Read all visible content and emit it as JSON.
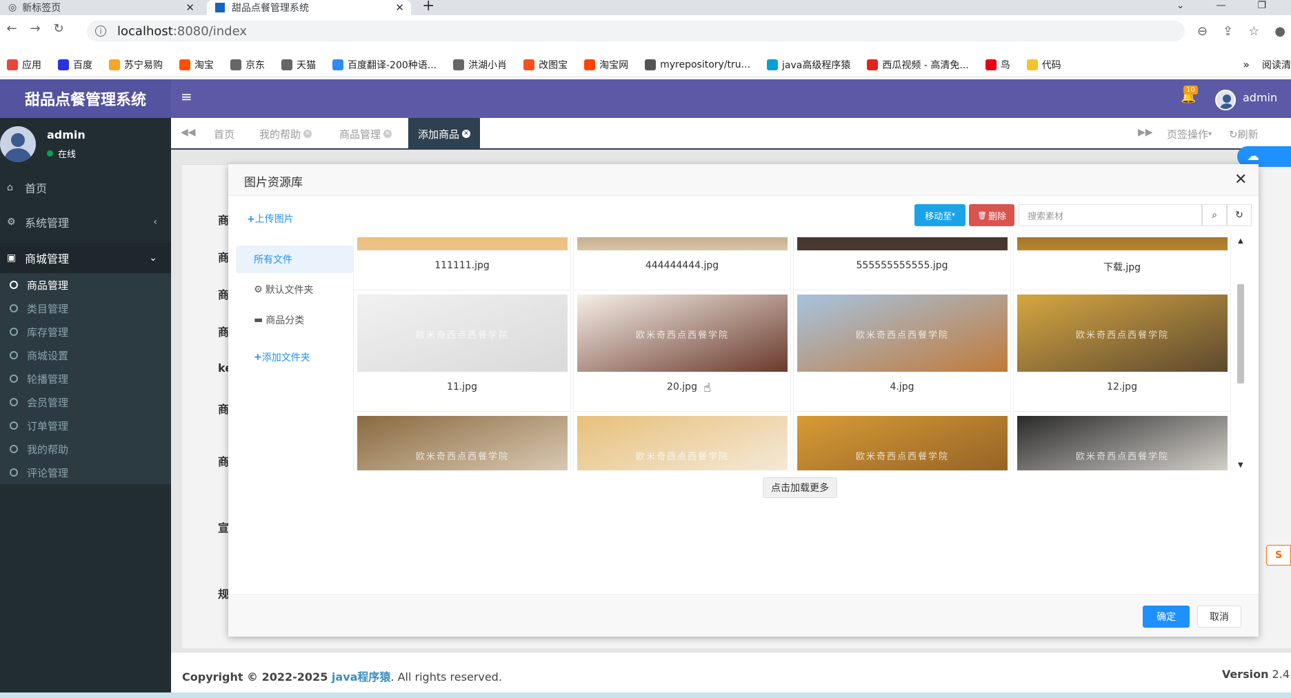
{
  "browser": {
    "tabs": [
      {
        "label": "新标签页"
      },
      {
        "label": "甜品点餐管理系统"
      }
    ],
    "url_host": "localhost",
    "url_path": ":8080/index",
    "bookmarks": [
      "应用",
      "百度",
      "苏宁易购",
      "淘宝",
      "京东",
      "天猫",
      "百度翻译-200种语...",
      "洪湖小肖",
      "改图宝",
      "淘宝网",
      "myrepository/tru...",
      "java高级程序猿",
      "西瓜视频 - 高清免...",
      "鸟",
      "代码"
    ],
    "reading_list": "阅读清",
    "bookmark_colors": [
      "#e8453c",
      "#2932e1",
      "#f5a623",
      "#ff5000",
      "#666666",
      "#666666",
      "#2d8cf0",
      "#666666",
      "#f4511e",
      "#ff4400",
      "#555555",
      "#00a1d6",
      "#e1251b",
      "#e60012",
      "#f4c430"
    ]
  },
  "app": {
    "brand": "甜品点餐管理系统",
    "notif_count": "10",
    "header_user": "admin",
    "accent": "#5c5aa6"
  },
  "sidebar": {
    "user": "admin",
    "status": "在线",
    "home": "首页",
    "system": "系统管理",
    "shop": "商城管理",
    "sub_items": [
      "商品管理",
      "类目管理",
      "库存管理",
      "商城设置",
      "轮播管理",
      "会员管理",
      "订单管理",
      "我的帮助",
      "评论管理"
    ]
  },
  "page_tabs": {
    "home": "首页",
    "help": "我的帮助",
    "goods": "商品管理",
    "add": "添加商品",
    "ops": "页签操作",
    "refresh": "刷新"
  },
  "page": {
    "labels": [
      "商",
      "商",
      "商",
      "商",
      "ke",
      "商",
      "商",
      "宣",
      "规"
    ]
  },
  "modal": {
    "title": "图片资源库",
    "upload": "上传图片",
    "move": "移动至",
    "delete": "删除",
    "search_placeholder": "搜索素材",
    "folders": {
      "all": "所有文件",
      "default": "默认文件夹",
      "category": "商品分类",
      "add": "添加文件夹"
    },
    "files_row1": [
      "111111.jpg",
      "444444444.jpg",
      "555555555555.jpg",
      "下载.jpg"
    ],
    "files_row2": [
      "11.jpg",
      "20.jpg",
      "4.jpg",
      "12.jpg"
    ],
    "watermark": "欧米奇西点西餐学院",
    "load_more": "点击加载更多",
    "ok": "确定",
    "cancel": "取消"
  },
  "footer": {
    "copyright": "Copyright © 2022-2025 ",
    "author": "java程序猿",
    "rights": ". All rights reserved.",
    "version_label": "Version",
    "version": "2.4"
  }
}
